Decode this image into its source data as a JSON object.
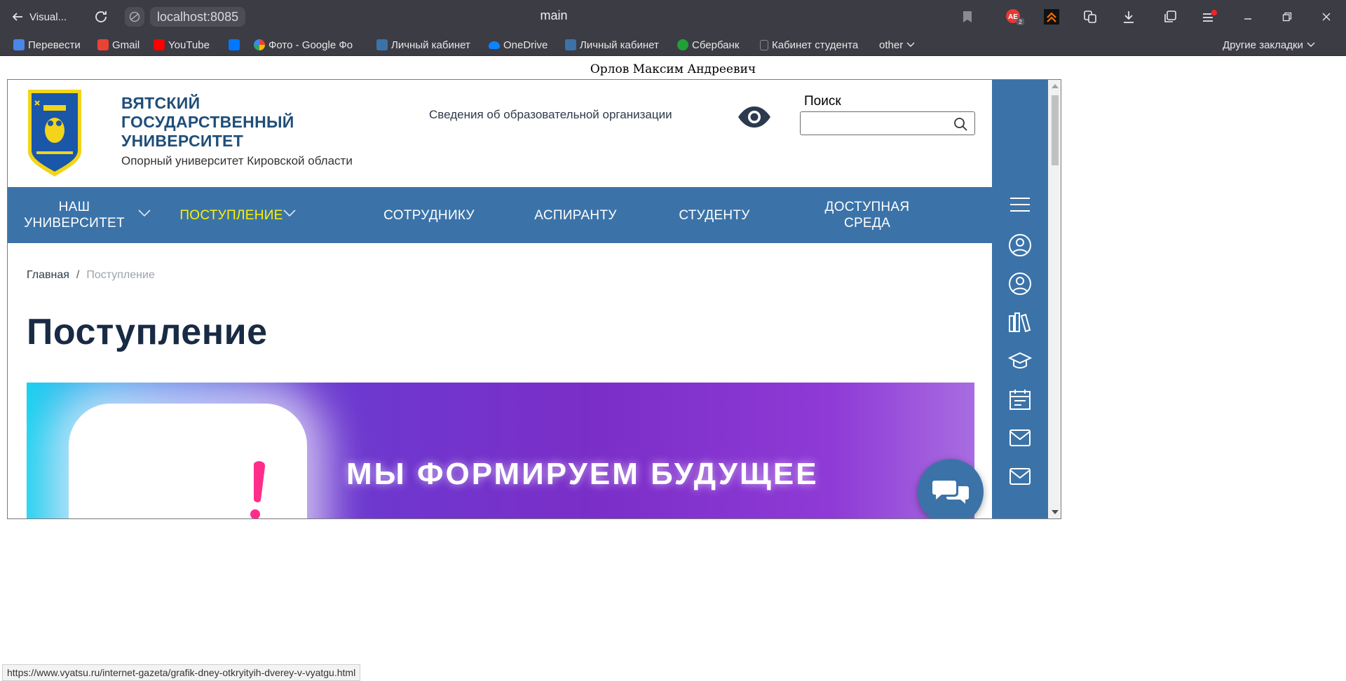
{
  "browser": {
    "back_tab_label": "Visual...",
    "url": "localhost:8085",
    "tab_title": "main",
    "extension_badge": "2",
    "bookmarks": [
      {
        "label": "Перевести",
        "icon": "translate-icon",
        "color": "#4a86e8"
      },
      {
        "label": "Gmail",
        "icon": "gmail-icon",
        "color": "#ea4335"
      },
      {
        "label": "YouTube",
        "icon": "youtube-icon",
        "color": "#ff0000"
      },
      {
        "label": "",
        "icon": "vk-icon",
        "color": "#0077ff"
      },
      {
        "label": "Фото - Google Фо",
        "icon": "google-photos-icon",
        "color": "#fbbc04"
      },
      {
        "label": "Личный кабинет",
        "icon": "owl-icon",
        "color": "#3b73a9"
      },
      {
        "label": "OneDrive",
        "icon": "onedrive-icon",
        "color": "#0a84ff"
      },
      {
        "label": "Личный кабинет",
        "icon": "owl-icon",
        "color": "#3b73a9"
      },
      {
        "label": "Сбербанк",
        "icon": "sberbank-icon",
        "color": "#21a038"
      },
      {
        "label": "Кабинет студента",
        "icon": "page-icon",
        "color": "#5a5a62"
      },
      {
        "label": "other",
        "icon": "chevron-down-icon",
        "color": ""
      }
    ],
    "other_bookmarks": "Другие закладки",
    "status_url": "https://www.vyatsu.ru/internet-gazeta/grafik-dney-otkryityih-dverey-v-vyatgu.html"
  },
  "page": {
    "author": "Орлов Максим Андреевич",
    "university": {
      "name_line1": "ВЯТСКИЙ",
      "name_line2": "ГОСУДАРСТВЕННЫЙ",
      "name_line3": "УНИВЕРСИТЕТ",
      "subtitle": "Опорный университет Кировской области"
    },
    "info_link": "Сведения об образовательной организации",
    "search": {
      "label": "Поиск",
      "placeholder": "",
      "value": ""
    },
    "nav": [
      {
        "label_line1": "НАШ",
        "label_line2": "УНИВЕРСИТЕТ",
        "active": false,
        "has_dropdown": true
      },
      {
        "label_line1": "ПОСТУПЛЕНИЕ",
        "label_line2": "",
        "active": true,
        "has_dropdown": true
      },
      {
        "label_line1": "СОТРУДНИКУ",
        "label_line2": "",
        "active": false,
        "has_dropdown": false
      },
      {
        "label_line1": "АСПИРАНТУ",
        "label_line2": "",
        "active": false,
        "has_dropdown": false
      },
      {
        "label_line1": "СТУДЕНТУ",
        "label_line2": "",
        "active": false,
        "has_dropdown": false
      },
      {
        "label_line1": "ДОСТУПНАЯ",
        "label_line2": "СРЕДА",
        "active": false,
        "has_dropdown": false
      }
    ],
    "breadcrumbs": {
      "home": "Главная",
      "separator": "/",
      "current": "Поступление"
    },
    "heading": "Поступление",
    "banner_text": "МЫ ФОРМИРУЕМ БУДУЩЕЕ",
    "side_icons": [
      "menu-icon",
      "user-circle-icon",
      "user-circle-icon",
      "books-icon",
      "graduation-cap-icon",
      "calendar-icon",
      "mail-icon",
      "mail-icon"
    ],
    "colors": {
      "nav_bg": "#3b73a9",
      "active_nav": "#fff200",
      "title": "#182a44",
      "university_name": "#1f4e79"
    }
  }
}
